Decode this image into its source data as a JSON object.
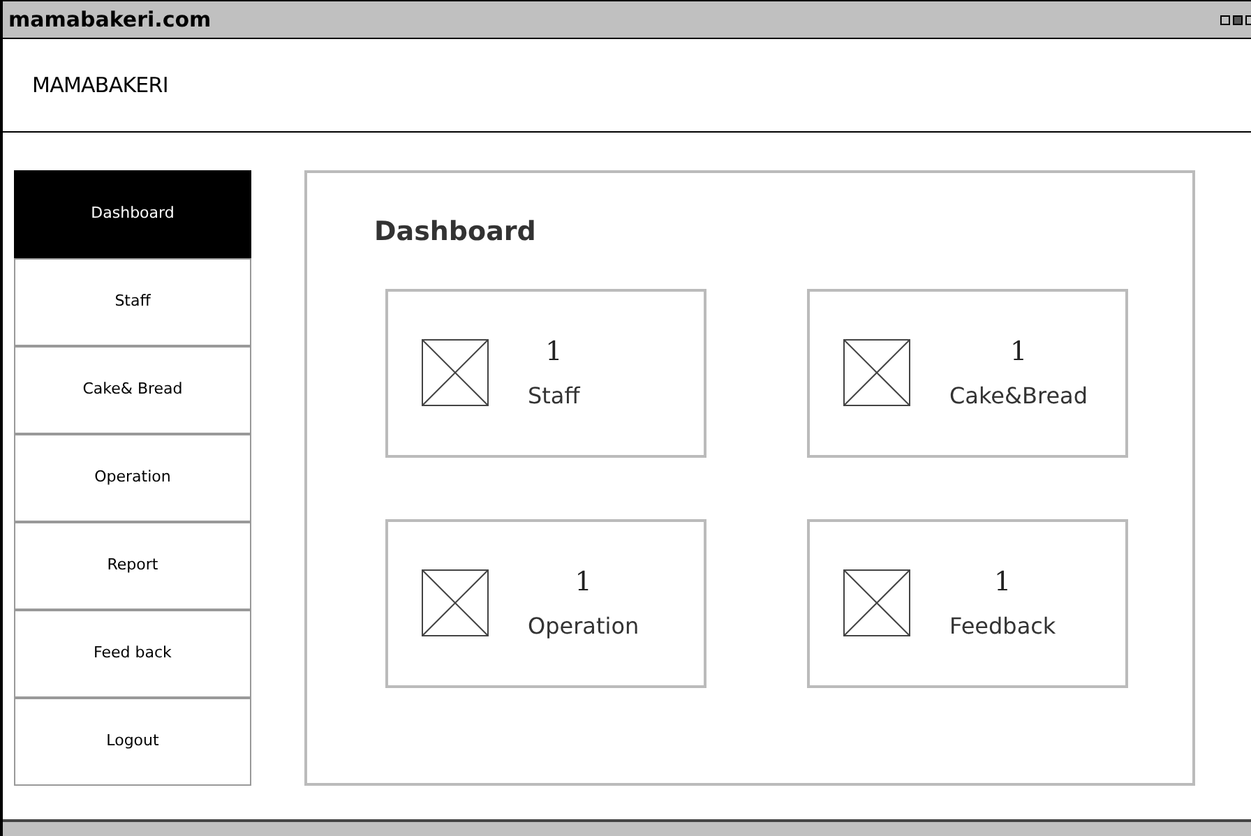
{
  "window": {
    "title": "mamabakeri.com"
  },
  "header": {
    "brand": "MAMABAKERI"
  },
  "sidebar": {
    "items": [
      {
        "label": "Dashboard",
        "selected": true
      },
      {
        "label": "Staff",
        "selected": false
      },
      {
        "label": "Cake& Bread",
        "selected": false
      },
      {
        "label": "Operation",
        "selected": false
      },
      {
        "label": "Report",
        "selected": false
      },
      {
        "label": "Feed back",
        "selected": false
      },
      {
        "label": "Logout",
        "selected": false
      }
    ]
  },
  "main": {
    "title": "Dashboard",
    "cards": [
      {
        "count": "1",
        "label": "Staff"
      },
      {
        "count": "1",
        "label": "Cake&Bread"
      },
      {
        "count": "1",
        "label": "Operation"
      },
      {
        "count": "1",
        "label": "Feedback"
      }
    ]
  }
}
